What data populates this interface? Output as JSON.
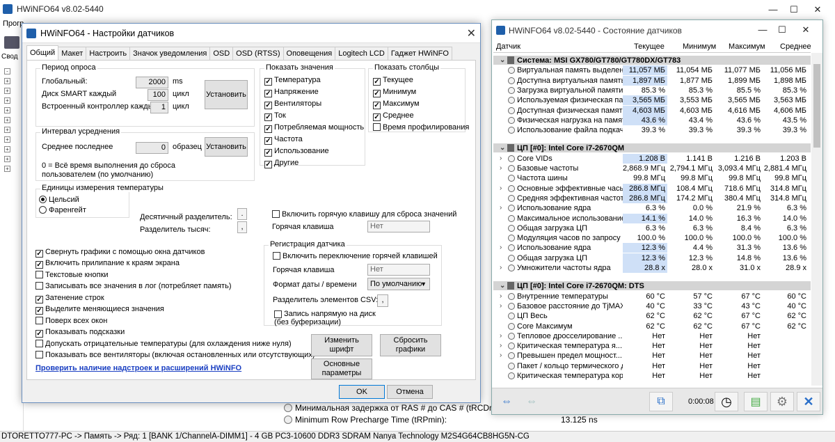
{
  "background_window": {
    "title": "HWiNFO64 v8.02-5440",
    "menu_fragment": "Прогр",
    "sidebar_fragment": "Свод",
    "rows": [
      {
        "label": "Минимальная задержка от RAS # до CAS # (tRCDmin):",
        "value": ""
      },
      {
        "label": "Minimum Row Precharge Time (tRPmin):",
        "value": "13.125 ns"
      }
    ],
    "status": "DTORETTO777-PC -> Память -> Ряд: 1 [BANK 1/ChannelA-DIMM1] - 4 GB PC3-10600 DDR3 SDRAM Nanya Technology M2S4G64CB8HG5N-CG"
  },
  "settings": {
    "title": "HWiNFO64 - Настройки датчиков",
    "close": "✕",
    "tabs": [
      "Общий",
      "Макет",
      "Настроить",
      "Значок уведомления",
      "OSD",
      "OSD (RTSS)",
      "Оповещения",
      "Logitech LCD",
      "Гаджет HWiNFO"
    ],
    "polling": {
      "legend": "Период опроса",
      "global_label": "Глобальный:",
      "global_value": "2000",
      "global_unit": "ms",
      "smart_label": "Диск SMART каждый",
      "smart_value": "100",
      "smart_unit": "цикл",
      "ec_label": "Встроенный контроллер каждый",
      "ec_value": "1",
      "ec_unit": "цикл",
      "set_button": "Установить"
    },
    "averaging": {
      "legend": "Интервал усреднения",
      "last_label": "Среднее последнее",
      "last_value": "0",
      "last_unit": "образец",
      "set_button": "Установить",
      "note": "0 = Всё время выполнения до сброса пользователем (по умолчанию)"
    },
    "units": {
      "legend": "Единицы измерения температуры",
      "celsius": "Цельсий",
      "fahrenheit": "Фаренгейт",
      "decimal_label": "Десятичный разделитель:",
      "decimal_value": ".",
      "thousands_label": "Разделитель тысяч:",
      "thousands_value": ","
    },
    "show_values": {
      "legend": "Показать значения",
      "items": [
        "Температура",
        "Напряжение",
        "Вентиляторы",
        "Ток",
        "Потребляемая мощность",
        "Частота",
        "Использование",
        "Другие"
      ]
    },
    "show_columns": {
      "legend": "Показать столбцы",
      "items": [
        {
          "label": "Текущее",
          "checked": true
        },
        {
          "label": "Минимум",
          "checked": true
        },
        {
          "label": "Максимум",
          "checked": true
        },
        {
          "label": "Среднее",
          "checked": true
        },
        {
          "label": "Время профилирования",
          "checked": false
        }
      ]
    },
    "reset_hotkey": {
      "enable_label": "Включить горячую клавишу для сброса значений",
      "hotkey_label": "Горячая клавиша",
      "hotkey_value": "Нет"
    },
    "logging": {
      "legend": "Регистрация датчика",
      "enable_label": "Включить переключение горячей клавишей",
      "hotkey_label": "Горячая клавиша",
      "hotkey_value": "Нет",
      "date_label": "Формат даты / времени",
      "date_value": "По умолчанию",
      "csv_label": "Разделитель элементов CSV:",
      "csv_value": ",",
      "direct_label": "Запись напрямую на диск (без буферизации)"
    },
    "options": [
      {
        "label": "Свернуть графики с помощью окна датчиков",
        "checked": true
      },
      {
        "label": "Включить прилипание к краям экрана",
        "checked": true
      },
      {
        "label": "Текстовые кнопки",
        "checked": false
      },
      {
        "label": "Записывать все значения в лог (потребляет память)",
        "checked": false
      },
      {
        "label": "Затенение строк",
        "checked": true
      },
      {
        "label": "Выделите меняющиеся значения",
        "checked": true
      },
      {
        "label": "Поверх всех окон",
        "checked": false
      },
      {
        "label": "Показывать подсказки",
        "checked": true
      },
      {
        "label": "Допускать отрицательные температуры (для охлаждения ниже нуля)",
        "checked": false
      },
      {
        "label": "Показывать все вентиляторы (включая остановленных или отсутствующих)",
        "checked": false
      }
    ],
    "link": "Проверить наличие надстроек и расширений HWiNFO",
    "change_font": "Изменить шрифт",
    "reset_graphs": "Сбросить графики",
    "main_params": "Основные параметры",
    "ok": "OK",
    "cancel": "Отмена"
  },
  "sensors": {
    "title": "HWiNFO64 v8.02-5440 - Состояние датчиков",
    "columns": [
      "Датчик",
      "Текущее",
      "Минимум",
      "Максимум",
      "Среднее"
    ],
    "sections": [
      {
        "name": "Система: MSI GX780/GT780/GT780DX/GT783",
        "rows": [
          {
            "n": "Виртуальная память выделена",
            "c": "11,057 МБ",
            "mi": "11,054 МБ",
            "ma": "11,077 МБ",
            "av": "11,056 МБ",
            "hl": true,
            "ex": ""
          },
          {
            "n": "Доступна виртуальная память",
            "c": "1,897 МБ",
            "mi": "1,877 МБ",
            "ma": "1,899 МБ",
            "av": "1,898 МБ",
            "hl": true,
            "ex": ""
          },
          {
            "n": "Загрузка виртуальной памяти",
            "c": "85.3 %",
            "mi": "85.3 %",
            "ma": "85.5 %",
            "av": "85.3 %",
            "hl": false,
            "ex": ""
          },
          {
            "n": "Используемая физическая память",
            "c": "3,565 МБ",
            "mi": "3,553 МБ",
            "ma": "3,565 МБ",
            "av": "3,563 МБ",
            "hl": true,
            "ex": ""
          },
          {
            "n": "Доступная физическая память",
            "c": "4,603 МБ",
            "mi": "4,603 МБ",
            "ma": "4,616 МБ",
            "av": "4,606 МБ",
            "hl": true,
            "ex": ""
          },
          {
            "n": "Физическая нагрузка на память",
            "c": "43.6 %",
            "mi": "43.4 %",
            "ma": "43.6 %",
            "av": "43.5 %",
            "hl": true,
            "ex": ""
          },
          {
            "n": "Использование файла подкачки",
            "c": "39.3 %",
            "mi": "39.3 %",
            "ma": "39.3 %",
            "av": "39.3 %",
            "hl": false,
            "ex": ""
          }
        ]
      },
      {
        "name": "ЦП [#0]: Intel Core i7-2670QM",
        "rows": [
          {
            "n": "Core VIDs",
            "c": "1.208 В",
            "mi": "1.141 В",
            "ma": "1.216 В",
            "av": "1.203 В",
            "hl": true,
            "ex": "›"
          },
          {
            "n": "Базовые частоты",
            "c": "2,868.9 МГц",
            "mi": "2,794.1 МГц",
            "ma": "3,093.4 МГц",
            "av": "2,881.4 МГц",
            "hl": false,
            "ex": "›"
          },
          {
            "n": "Частота шины",
            "c": "99.8 МГц",
            "mi": "99.8 МГц",
            "ma": "99.8 МГц",
            "av": "99.8 МГц",
            "hl": false,
            "ex": ""
          },
          {
            "n": "Основные эффективные часы",
            "c": "286.8 МГц",
            "mi": "108.4 МГц",
            "ma": "718.6 МГц",
            "av": "314.8 МГц",
            "hl": true,
            "ex": "›"
          },
          {
            "n": "Средняя эффективная частота",
            "c": "286.8 МГц",
            "mi": "174.2 МГц",
            "ma": "380.4 МГц",
            "av": "314.8 МГц",
            "hl": true,
            "ex": ""
          },
          {
            "n": "Использование ядра",
            "c": "6.3 %",
            "mi": "0.0 %",
            "ma": "21.9 %",
            "av": "6.3 %",
            "hl": false,
            "ex": "›"
          },
          {
            "n": "Максимальное использование ...",
            "c": "14.1 %",
            "mi": "14.0 %",
            "ma": "16.3 %",
            "av": "14.0 %",
            "hl": true,
            "ex": ""
          },
          {
            "n": "Общая загрузка ЦП",
            "c": "6.3 %",
            "mi": "6.3 %",
            "ma": "8.4 %",
            "av": "6.3 %",
            "hl": false,
            "ex": ""
          },
          {
            "n": "Модуляция часов по запросу",
            "c": "100.0 %",
            "mi": "100.0 %",
            "ma": "100.0 %",
            "av": "100.0 %",
            "hl": false,
            "ex": ""
          },
          {
            "n": "Использование ядра",
            "c": "12.3 %",
            "mi": "4.4 %",
            "ma": "31.3 %",
            "av": "13.6 %",
            "hl": true,
            "ex": "›"
          },
          {
            "n": "Общая загрузка ЦП",
            "c": "12.3 %",
            "mi": "12.3 %",
            "ma": "14.8 %",
            "av": "13.6 %",
            "hl": true,
            "ex": ""
          },
          {
            "n": "Умножители частоты ядра",
            "c": "28.8 x",
            "mi": "28.0 x",
            "ma": "31.0 x",
            "av": "28.9 x",
            "hl": true,
            "ex": "›"
          }
        ]
      },
      {
        "name": "ЦП [#0]: Intel Core i7-2670QM: DTS",
        "rows": [
          {
            "n": "Внутренние температуры",
            "c": "60 °C",
            "mi": "57 °C",
            "ma": "67 °C",
            "av": "60 °C",
            "hl": false,
            "ex": "›"
          },
          {
            "n": "Базовое расстояние до TjMAX",
            "c": "40 °C",
            "mi": "33 °C",
            "ma": "43 °C",
            "av": "40 °C",
            "hl": false,
            "ex": "›"
          },
          {
            "n": "ЦП Весь",
            "c": "62 °C",
            "mi": "62 °C",
            "ma": "67 °C",
            "av": "62 °C",
            "hl": false,
            "ex": ""
          },
          {
            "n": "Core Максимум",
            "c": "62 °C",
            "mi": "62 °C",
            "ma": "67 °C",
            "av": "62 °C",
            "hl": false,
            "ex": ""
          },
          {
            "n": "Тепловое дросселирование ...",
            "c": "Нет",
            "mi": "Нет",
            "ma": "Нет",
            "av": "",
            "hl": false,
            "ex": "›"
          },
          {
            "n": "Критическая температура я...",
            "c": "Нет",
            "mi": "Нет",
            "ma": "Нет",
            "av": "",
            "hl": false,
            "ex": "›"
          },
          {
            "n": "Превышен предел мощност...",
            "c": "Нет",
            "mi": "Нет",
            "ma": "Нет",
            "av": "",
            "hl": false,
            "ex": "›"
          },
          {
            "n": "Пакет / кольцо термического д...",
            "c": "Нет",
            "mi": "Нет",
            "ma": "Нет",
            "av": "",
            "hl": false,
            "ex": ""
          },
          {
            "n": "Критическая температура кор...",
            "c": "Нет",
            "mi": "Нет",
            "ma": "Нет",
            "av": "",
            "hl": false,
            "ex": ""
          }
        ]
      }
    ],
    "timer": "0:00:08"
  }
}
